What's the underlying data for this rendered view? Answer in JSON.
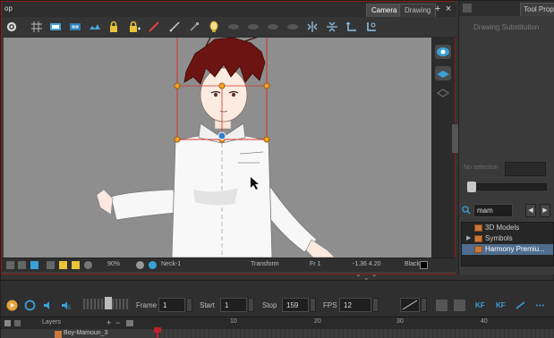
{
  "camera_panel": {
    "corner_label": "op",
    "tabs": [
      {
        "label": "Camera",
        "active": true
      },
      {
        "label": "Drawing",
        "active": false
      }
    ],
    "add_tab_glyph": "+",
    "close_tab_glyph": "×"
  },
  "toolbar": {
    "icons": [
      "gear-icon",
      "grid-icon",
      "lightbox-icon",
      "onion-skin-icon",
      "lock-icon",
      "lock-add-icon",
      "brush-icon",
      "pencil-icon",
      "eye-dropper-icon",
      "bulb-icon",
      "layer-a-icon",
      "layer-b-icon",
      "layer-c-icon",
      "flip-horizontal-icon",
      "flip-vertical-icon",
      "reset-icon",
      "reset-transform-icon"
    ]
  },
  "status_bar": {
    "zoom": "90%",
    "node": "Neck-1",
    "tool": "Transform",
    "frame": "Fr 1",
    "coords": "-1.36  4.20",
    "color_label": "Black"
  },
  "right_panel": {
    "tab_label": "Tool Prope",
    "title": "Drawing Substitution",
    "no_selection": "No selection",
    "slider_value": 0,
    "search_value": "mam",
    "library_items": [
      {
        "label": "3D Models",
        "selected": false,
        "expandable": false
      },
      {
        "label": "Symbols",
        "selected": false,
        "expandable": true
      },
      {
        "label": "Harmony Premiu...",
        "selected": true,
        "expandable": false
      }
    ]
  },
  "timeline": {
    "frame_label": "Frame",
    "frame_value": "1",
    "start_label": "Start",
    "start_value": "1",
    "stop_label": "Stop",
    "stop_value": "159",
    "fps_label": "FPS",
    "fps_value": "12",
    "kf_label": "KF",
    "layers_header": "Layers",
    "layer_name": "Boy-Mamoun_3",
    "ruler_ticks": [
      "10",
      "20",
      "30",
      "40"
    ],
    "current_frame": 1
  },
  "colors": {
    "panel_border_active": "#8b1a1a",
    "selection_orange": "#f5a623",
    "selection_red": "#d43030",
    "playhead": "#c0202a",
    "accent_blue": "#3aa0d8",
    "library_selected": "#4e6d8e"
  }
}
